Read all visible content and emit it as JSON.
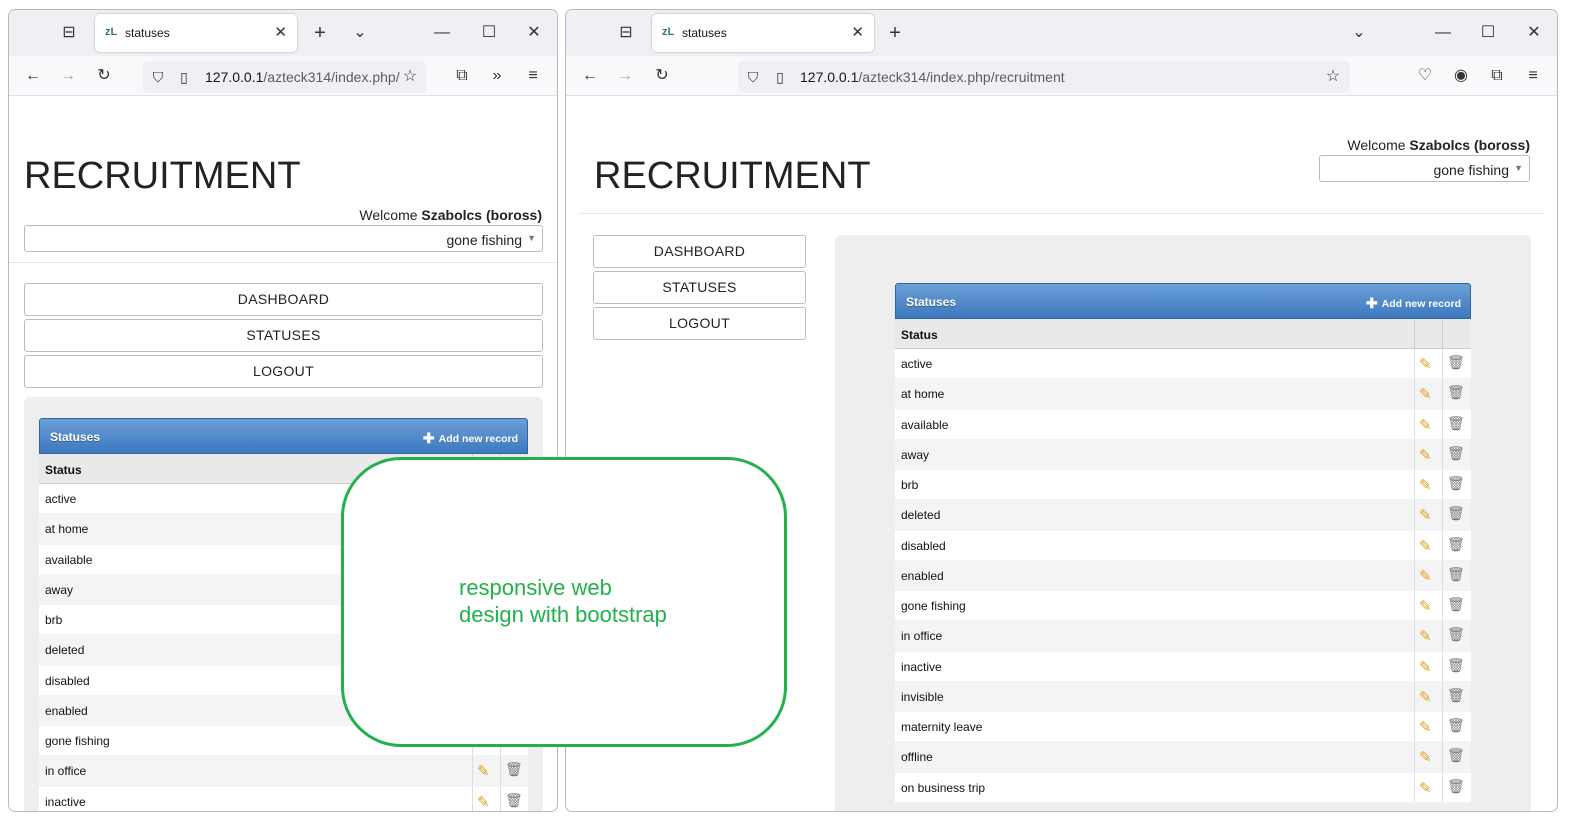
{
  "left_window": {
    "tab_title": "statuses",
    "tab_favicon": "zL",
    "url_host": "127.0.0.1",
    "url_path": "/azteck314/index.php/",
    "page_title": "RECRUITMENT",
    "welcome_prefix": "Welcome",
    "welcome_user": "Szabolcs (boross)",
    "status_select": "gone fishing",
    "nav": [
      "DASHBOARD",
      "STATUSES",
      "LOGOUT"
    ],
    "grid_title": "Statuses",
    "add_record": "Add new record",
    "column_status": "Status",
    "rows": [
      "active",
      "at home",
      "available",
      "away",
      "brb",
      "deleted",
      "disabled",
      "enabled",
      "gone fishing",
      "in office",
      "inactive"
    ]
  },
  "right_window": {
    "tab_title": "statuses",
    "tab_favicon": "zL",
    "url_host": "127.0.0.1",
    "url_path": "/azteck314/index.php/recruitment",
    "page_title": "RECRUITMENT",
    "welcome_prefix": "Welcome",
    "welcome_user": "Szabolcs (boross)",
    "status_select": "gone fishing",
    "nav": [
      "DASHBOARD",
      "STATUSES",
      "LOGOUT"
    ],
    "grid_title": "Statuses",
    "add_record": "Add new record",
    "column_status": "Status",
    "rows": [
      "active",
      "at home",
      "available",
      "away",
      "brb",
      "deleted",
      "disabled",
      "enabled",
      "gone fishing",
      "in office",
      "inactive",
      "invisible",
      "maternity leave",
      "offline",
      "on business trip"
    ]
  },
  "annotation": {
    "line1": "responsive web",
    "line2": "design with bootstrap"
  },
  "icons": {
    "edit": "edit-pencil-icon",
    "delete": "trash-icon",
    "add": "plus-icon"
  },
  "colors": {
    "grid_header": "#3d78bf",
    "annotation": "#22b14c"
  }
}
